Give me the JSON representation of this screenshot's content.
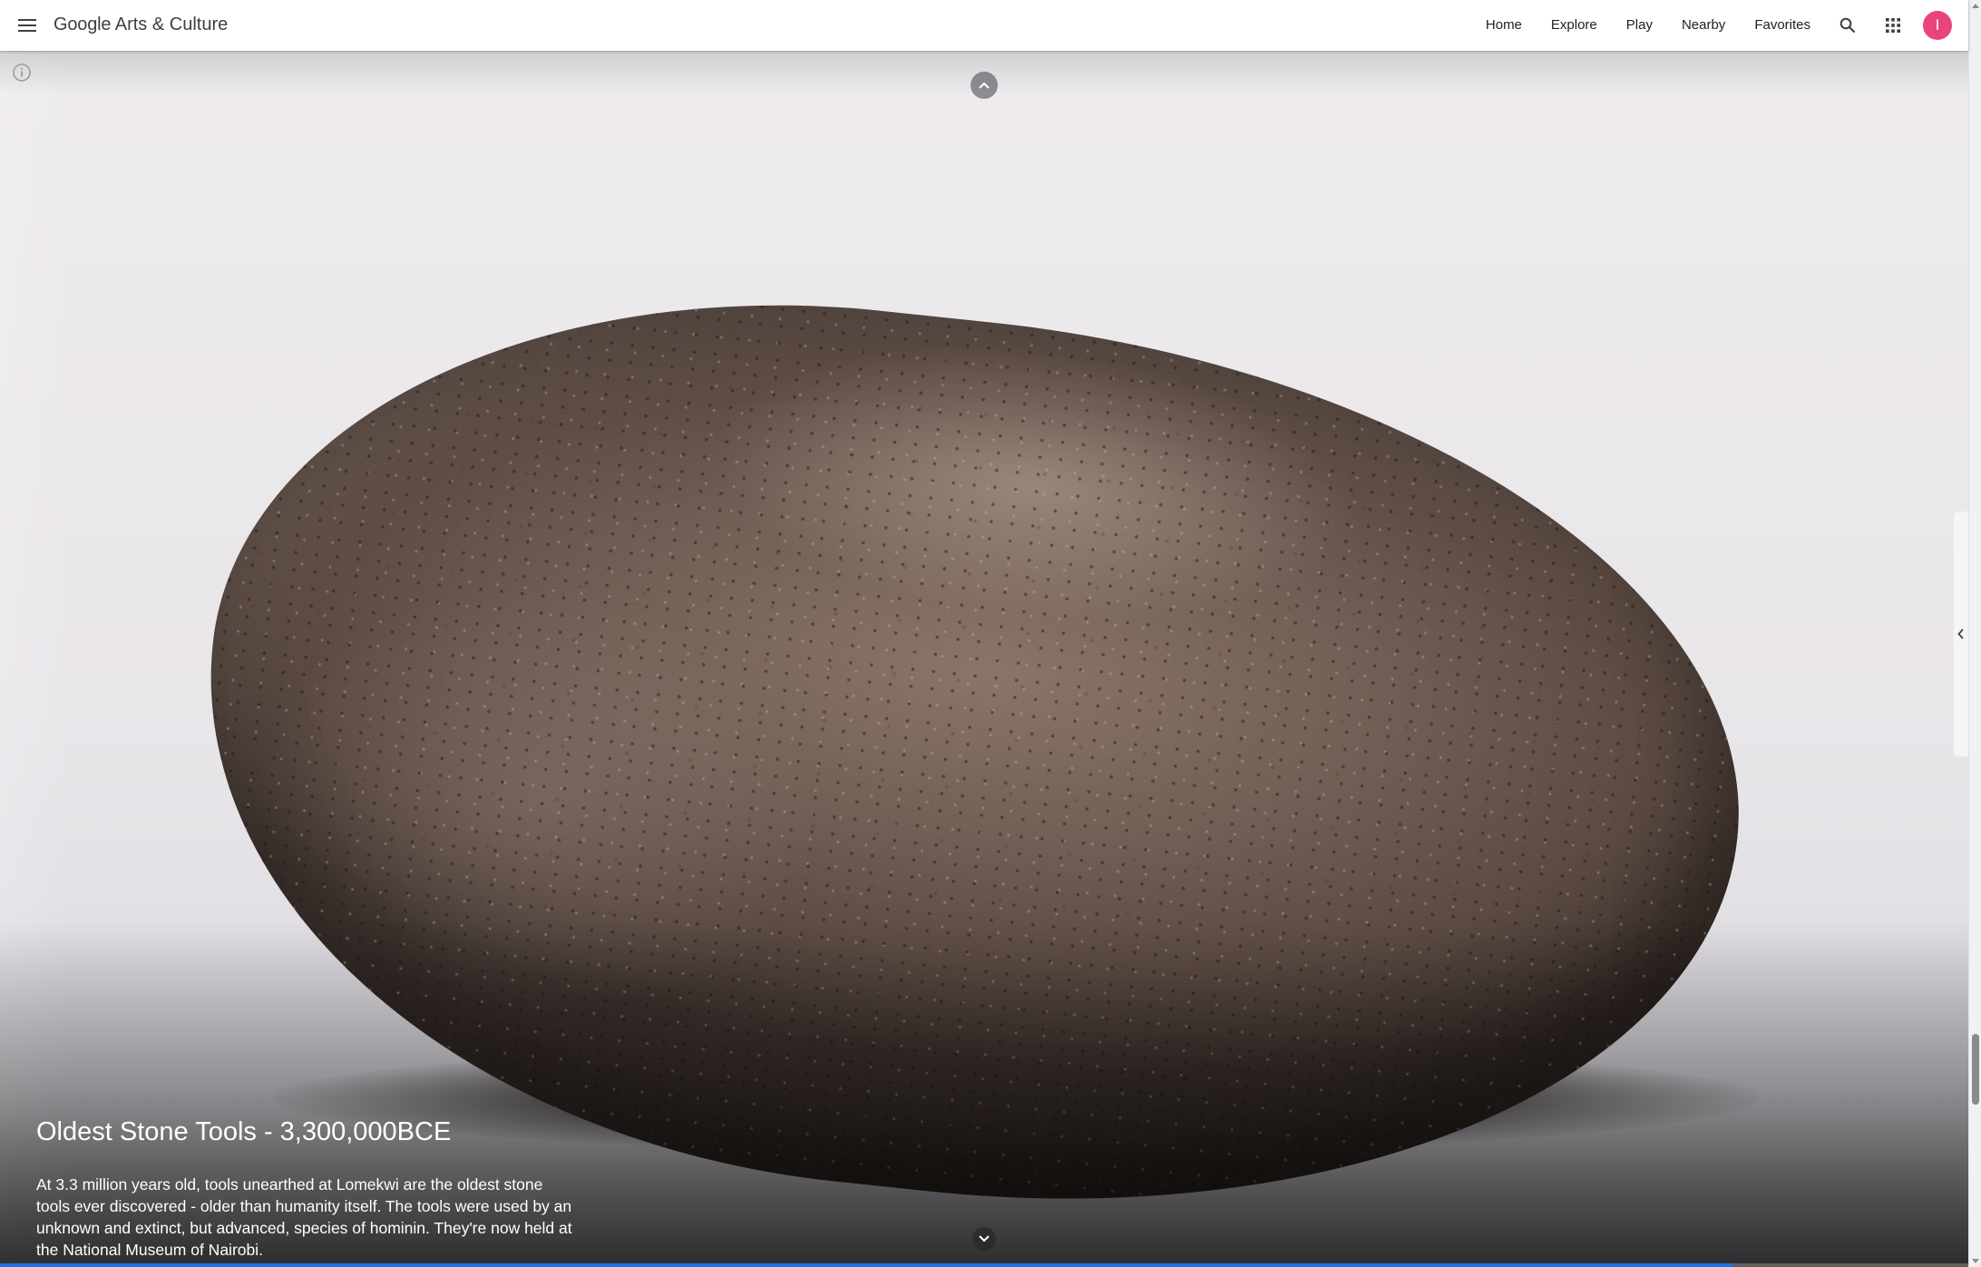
{
  "header": {
    "logo_brand": "Google",
    "logo_rest": " Arts & Culture",
    "nav": [
      "Home",
      "Explore",
      "Play",
      "Nearby",
      "Favorites"
    ],
    "avatar_letter": "I",
    "menu_icon": "hamburger-menu-icon",
    "search_icon": "search-icon",
    "apps_icon": "apps-grid-icon"
  },
  "story": {
    "title": "Oldest Stone Tools - 3,300,000BCE",
    "description": "At 3.3 million years old, tools unearthed at Lomekwi are the oldest stone tools ever discovered - older than humanity itself. The tools were used by an unknown and extinct, but advanced, species of hominin. They're now held at the National Museum of Nairobi.",
    "progress_percent": 88
  },
  "colors": {
    "accent": "#1a73e8",
    "avatar": "#e8457a"
  }
}
